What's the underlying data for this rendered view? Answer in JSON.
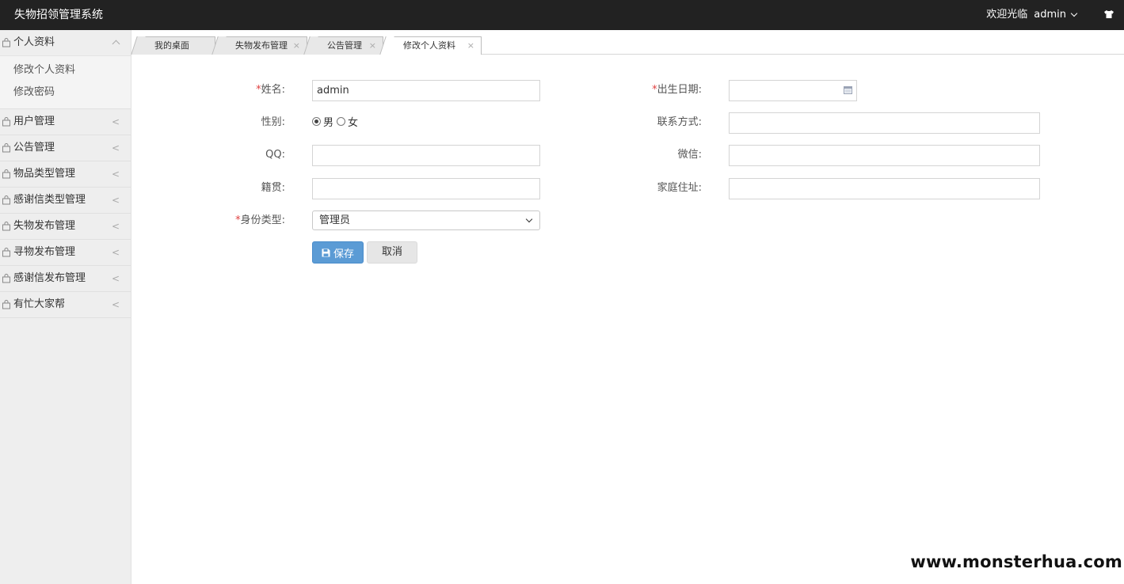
{
  "app": {
    "title": "失物招领管理系统"
  },
  "header": {
    "welcome": "欢迎光临",
    "username": "admin"
  },
  "sidebar": {
    "groups": [
      {
        "label": "个人资料",
        "expanded": true,
        "items": [
          "修改个人资料",
          "修改密码"
        ]
      },
      {
        "label": "用户管理"
      },
      {
        "label": "公告管理"
      },
      {
        "label": "物品类型管理"
      },
      {
        "label": "感谢信类型管理"
      },
      {
        "label": "失物发布管理"
      },
      {
        "label": "寻物发布管理"
      },
      {
        "label": "感谢信发布管理"
      },
      {
        "label": "有忙大家帮"
      }
    ],
    "collapsed_arrow": "<"
  },
  "tabs": [
    {
      "label": "我的桌面"
    },
    {
      "label": "失物发布管理",
      "close": "×"
    },
    {
      "label": "公告管理",
      "close": "×"
    },
    {
      "label": "修改个人资料",
      "close": "×",
      "active": true
    }
  ],
  "form": {
    "required_mark": "*",
    "name": {
      "label": "姓名:",
      "value": "admin"
    },
    "birthday": {
      "label": "出生日期:",
      "value": ""
    },
    "gender": {
      "label": "性别:",
      "options": [
        "男",
        "女"
      ],
      "selected": "男"
    },
    "contact": {
      "label": "联系方式:",
      "value": ""
    },
    "qq": {
      "label": "QQ:",
      "value": ""
    },
    "wechat": {
      "label": "微信:",
      "value": ""
    },
    "hometown": {
      "label": "籍贯:",
      "value": ""
    },
    "address": {
      "label": "家庭住址:",
      "value": ""
    },
    "identity": {
      "label": "身份类型:",
      "value": "管理员"
    },
    "save_label": "保存",
    "cancel_label": "取消"
  },
  "watermark": "www.monsterhua.com",
  "colors": {
    "topbar": "#222222",
    "primary_button": "#5b9bd5",
    "required": "#e04040",
    "sidebar": "#eeeeee"
  }
}
